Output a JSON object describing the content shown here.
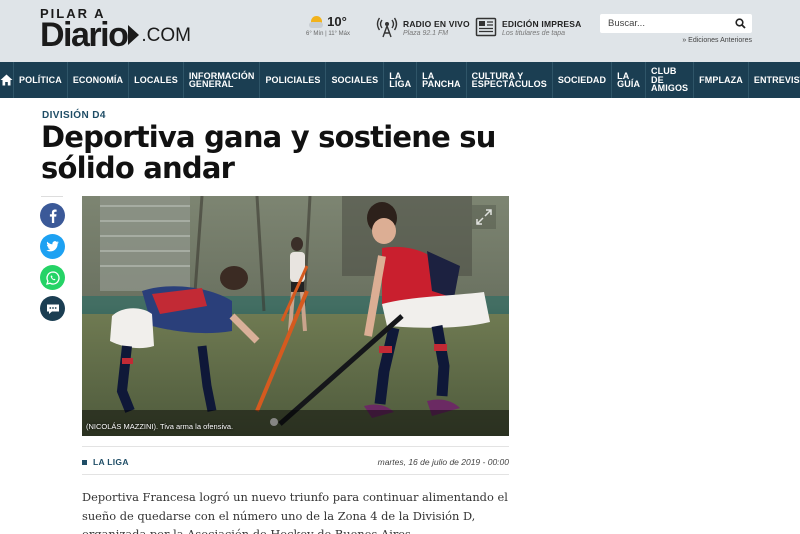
{
  "header": {
    "logo_small": "PILAR A",
    "logo_big": "Diario",
    "logo_com": ".COM",
    "weather": {
      "temp": "10°",
      "detail": "6° Mín | 11° Máx",
      "icon": "partly-cloudy-icon"
    },
    "radio": {
      "title": "RADIO EN VIVO",
      "subtitle": "Plaza 92.1 FM",
      "icon": "radio-tower-icon"
    },
    "edicion": {
      "title": "EDICIÓN IMPRESA",
      "subtitle": "Los titulares de tapa",
      "icon": "newspaper-icon"
    },
    "search": {
      "placeholder": "Buscar...",
      "icon": "search-icon"
    },
    "ediciones_link": "» Ediciones Anteriores"
  },
  "nav": {
    "home_icon": "home-icon",
    "items": [
      "POLÍTICA",
      "ECONOMÍA",
      "LOCALES",
      "INFORMACIÓN\nGENERAL",
      "POLICIALES",
      "SOCIALES",
      "LA\nLIGA",
      "LA\nPANCHA",
      "CULTURA Y\nESPECTÁCULOS",
      "SOCIEDAD",
      "LA\nGUÍA",
      "CLUB\nDE\nAMIGOS",
      "FMPLAZA",
      "ENTREVISTAS"
    ]
  },
  "article": {
    "kicker": "DIVISIÓN D4",
    "headline": "Deportiva gana y sostiene su sólido andar",
    "caption": "(NICOLÁS MAZZINI). Tiva arma la ofensiva.",
    "section": "LA LIGA",
    "date": "martes, 16 de julio de 2019 - 00:00",
    "body": "Deportiva Francesa logró un nuevo triunfo para continuar alimentando el sueño de quedarse con el número uno de la Zona 4 de la División D, organizada por la Asociación de Hockey de Buenos Aires."
  },
  "share": [
    {
      "name": "facebook",
      "glyph": "f",
      "color": "#3b5998"
    },
    {
      "name": "twitter",
      "glyph": "t",
      "color": "#1da1f2"
    },
    {
      "name": "whatsapp",
      "glyph": "w",
      "color": "#25d366"
    },
    {
      "name": "comments",
      "glyph": "c",
      "color": "#1b3e52"
    }
  ],
  "colors": {
    "nav_bg": "#1b3e52",
    "header_bg": "#dfe4e8",
    "accent": "#1f4d66"
  }
}
